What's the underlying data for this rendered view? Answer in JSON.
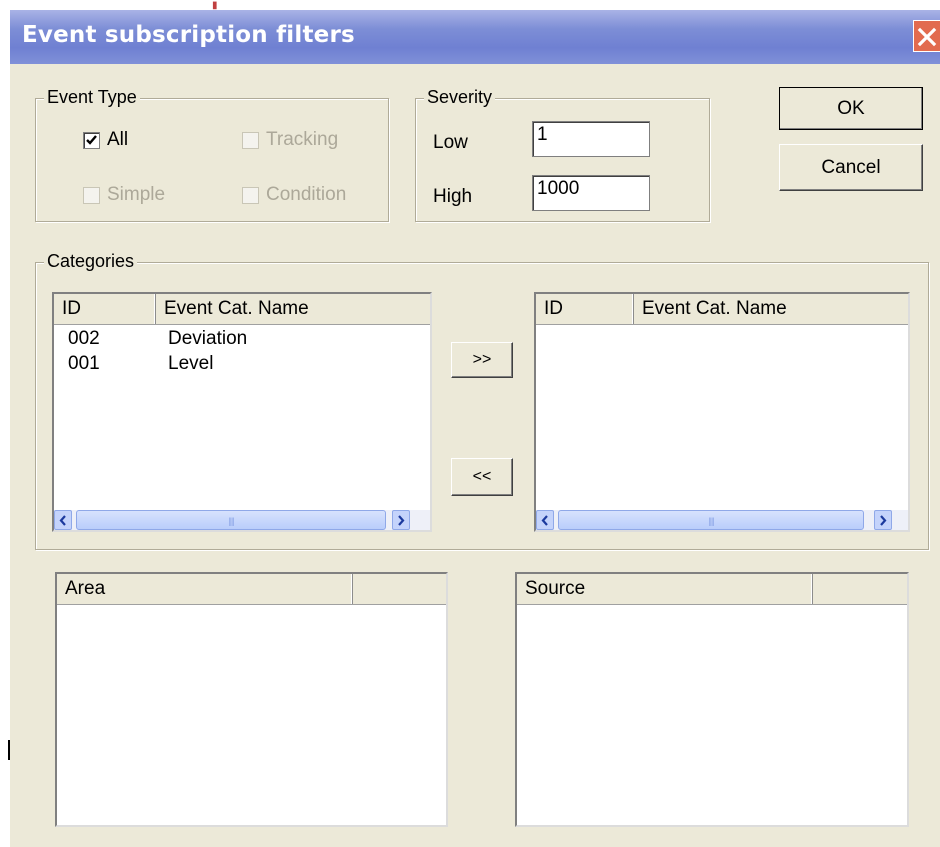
{
  "window": {
    "title": "Event subscription filters"
  },
  "event_type": {
    "legend": "Event Type",
    "all": {
      "label": "All",
      "checked": true,
      "enabled": true
    },
    "tracking": {
      "label": "Tracking",
      "checked": false,
      "enabled": false
    },
    "simple": {
      "label": "Simple",
      "checked": false,
      "enabled": false
    },
    "condition": {
      "label": "Condition",
      "checked": false,
      "enabled": false
    }
  },
  "severity": {
    "legend": "Severity",
    "low_label": "Low",
    "low_value": "1",
    "high_label": "High",
    "high_value": "1000"
  },
  "buttons": {
    "ok": "OK",
    "cancel": "Cancel",
    "add": ">>",
    "remove": "<<"
  },
  "categories": {
    "legend": "Categories",
    "available": {
      "columns": [
        "ID",
        "Event Cat. Name"
      ],
      "rows": [
        {
          "id": "002",
          "name": "Deviation"
        },
        {
          "id": "001",
          "name": "Level"
        }
      ]
    },
    "selected": {
      "columns": [
        "ID",
        "Event Cat. Name"
      ],
      "rows": []
    }
  },
  "area": {
    "columns": [
      "Area",
      ""
    ]
  },
  "source": {
    "columns": [
      "Source",
      ""
    ]
  },
  "icons": {
    "close": "close-x-icon",
    "check": "checkmark-icon",
    "scroll_left": "arrow-left-icon",
    "scroll_right": "arrow-right-icon",
    "grip": "scrollbar-grip-icon"
  },
  "colors": {
    "titlebar": "#7d8ed6",
    "close": "#e26b4f",
    "dialog_bg": "#ece9d8"
  }
}
